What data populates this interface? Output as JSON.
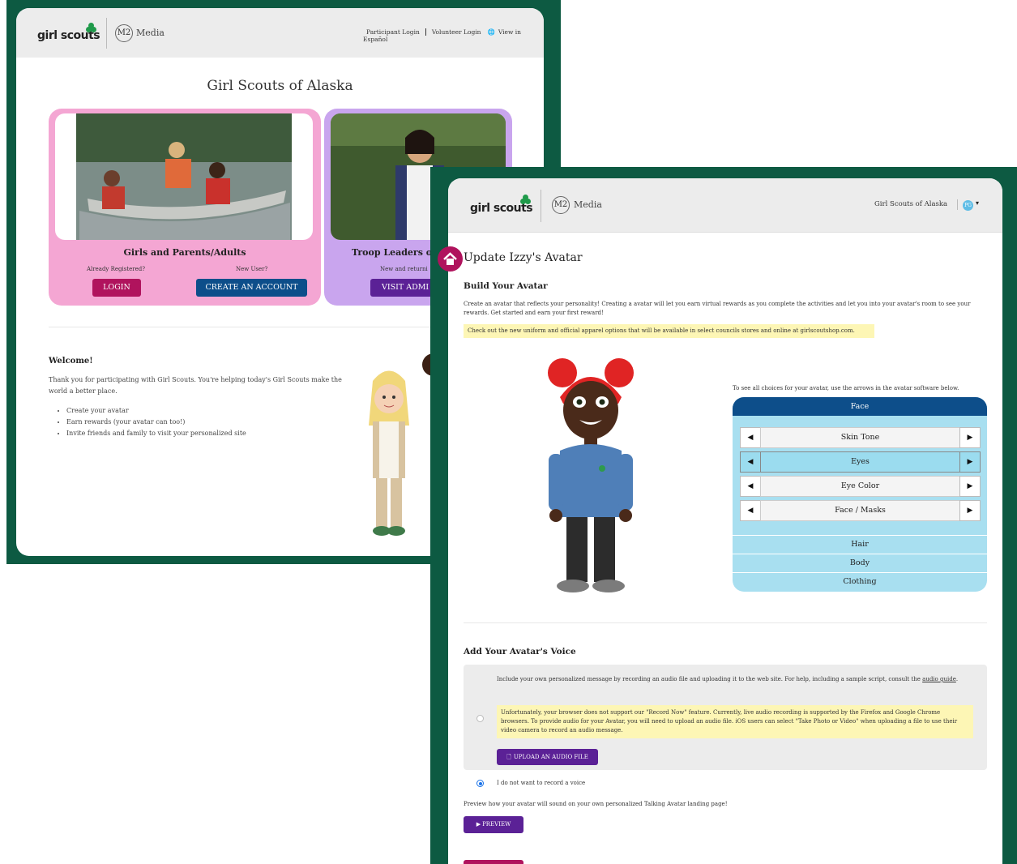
{
  "colors": {
    "frame_green": "#0d5a42",
    "magenta": "#b0135d",
    "navy": "#0d4e8a",
    "purple": "#5b2196",
    "pink_card": "#f4a6d3",
    "lavender_card": "#c9a5ee",
    "light_blue": "#a8dff0",
    "note_yellow": "#fdf6b5"
  },
  "window1": {
    "logo_text": "girl scouts",
    "m2_badge": "M2",
    "m2_label": "Media",
    "links": {
      "participant_login": "Participant Login",
      "volunteer_login": "Volunteer Login",
      "spanish": "View in Español"
    },
    "page_title": "Girl Scouts of Alaska",
    "cards": [
      {
        "heading": "Girls and Parents/Adults",
        "sub_left": "Already Registered?",
        "sub_right": "New User?",
        "btn_left": "LOGIN",
        "btn_right": "CREATE AN ACCOUNT"
      },
      {
        "heading": "Troop Leaders or",
        "sub": "New and returni",
        "btn": "VISIT ADMI"
      }
    ],
    "welcome": {
      "heading": "Welcome!",
      "paragraph": "Thank you for participating with Girl Scouts. You're helping today's Girl Scouts make the world a better place.",
      "items": [
        "Create your avatar",
        "Earn rewards (your avatar can too!)",
        "Invite friends and family to visit your personalized site"
      ]
    }
  },
  "window2": {
    "logo_text": "girl scouts",
    "m2_badge": "M2",
    "m2_label": "Media",
    "org": "Girl Scouts of Alaska",
    "user_initials": "PG",
    "page_title": "Update Izzy's Avatar",
    "build": {
      "heading": "Build Your Avatar",
      "intro": "Create an avatar that reflects your personality! Creating a avatar will let you earn virtual rewards as you complete the activities and let you into your avatar's room to see your rewards. Get started and earn your first reward!",
      "notice": "Check out the new uniform and official apparel options that will be available in select councils stores and online at girlscoutshop.com."
    },
    "picker": {
      "hint": "To see all choices for your avatar, use the arrows in the avatar software below.",
      "section_face": "Face",
      "options": [
        "Skin Tone",
        "Eyes",
        "Eye Color",
        "Face / Masks"
      ],
      "active_option": "Eyes",
      "categories": [
        "Hair",
        "Body",
        "Clothing"
      ]
    },
    "voice": {
      "heading": "Add Your Avatar's Voice",
      "instructions": "Include your own personalized message by recording an audio file and uploading it to the web site. For help, including a sample script, consult the",
      "guide_link": "audio guide",
      "warning": "Unfortunately, your browser does not support our \"Record Now\" feature. Currently, live audio recording is supported by the Firefox and Google Chrome browsers. To provide audio for your Avatar, you will need to upload an audio file. iOS users can select \"Take Photo or Video\" when uploading a file to use their video camera to record an audio message.",
      "upload_btn": "UPLOAD AN AUDIO FILE",
      "no_voice": "I do not want to record a voice",
      "preview_text": "Preview how your avatar will sound on your own personalized Talking Avatar landing page!",
      "preview_btn": "PREVIEW"
    }
  }
}
